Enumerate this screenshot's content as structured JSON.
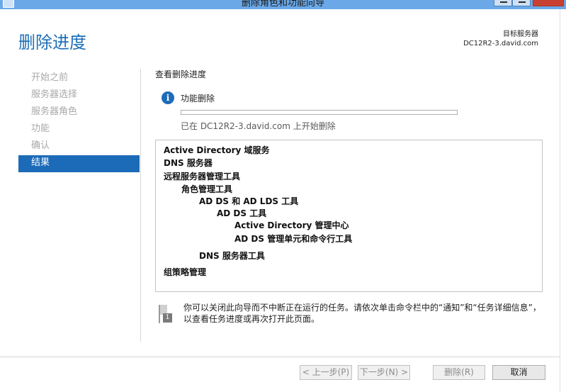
{
  "window": {
    "title": "删除角色和功能向导",
    "controls": [
      "minimize",
      "maximize",
      "close"
    ]
  },
  "header": {
    "title": "删除进度",
    "target_label": "目标服务器",
    "target_server": "DC12R2-3.david.com"
  },
  "nav": {
    "items": [
      {
        "label": "开始之前",
        "active": false
      },
      {
        "label": "服务器选择",
        "active": false
      },
      {
        "label": "服务器角色",
        "active": false
      },
      {
        "label": "功能",
        "active": false
      },
      {
        "label": "确认",
        "active": false
      },
      {
        "label": "结果",
        "active": true
      }
    ]
  },
  "main": {
    "section_label": "查看删除进度",
    "feature_title": "功能删除",
    "progress_fraction": 0.0,
    "status": "已在 DC12R2-3.david.com 上开始删除",
    "results": [
      "Active Directory 域服务",
      "DNS 服务器",
      "远程服务器管理工具",
      "角色管理工具",
      "AD DS 和 AD LDS 工具",
      "AD DS 工具",
      "Active Directory 管理中心",
      "AD DS 管理单元和命令行工具",
      "DNS 服务器工具",
      "组策略管理"
    ],
    "note": "你可以关闭此向导而不中断正在运行的任务。请依次单击命令栏中的“通知”和“任务详细信息”，以查看任务进度或再次打开此页面。",
    "note_badge": "1"
  },
  "buttons": {
    "prev": "< 上一步(P)",
    "next": "下一步(N) >",
    "remove": "删除(R)",
    "cancel": "取消"
  },
  "colors": {
    "accent": "#1c6bb8",
    "title_blue": "#1d6fb8",
    "titlebar": "#6aa8e8",
    "disabled_text": "#a8a8a8"
  }
}
